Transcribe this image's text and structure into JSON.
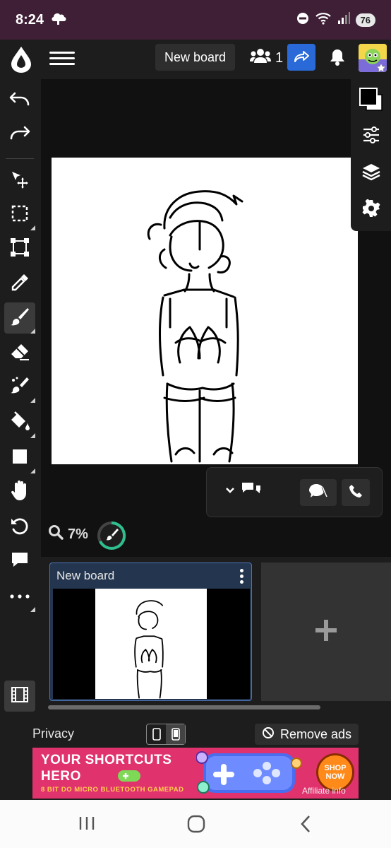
{
  "status_bar": {
    "time": "8:24",
    "battery": "76"
  },
  "topbar": {
    "board_name": "New board",
    "user_count": "1"
  },
  "canvas": {
    "zoom_label": "7%"
  },
  "frames": {
    "items": [
      {
        "title": "New board"
      }
    ]
  },
  "ads": {
    "privacy_label": "Privacy",
    "remove_ads_label": "Remove ads",
    "banner": {
      "headline_line1": "YOUR SHORTCUTS",
      "headline_line2": "HERO",
      "subline": "8 BIT DO MICRO BLUETOOTH GAMEPAD",
      "cta_line1": "SHOP",
      "cta_line2": "NOW",
      "affiliate": "Affiliate info"
    }
  },
  "colors": {
    "accent_blue": "#2a6ad8",
    "status_bar": "#3f1f36",
    "brush_ring": "#2fbf8f",
    "banner_bg": "#e0336e"
  }
}
